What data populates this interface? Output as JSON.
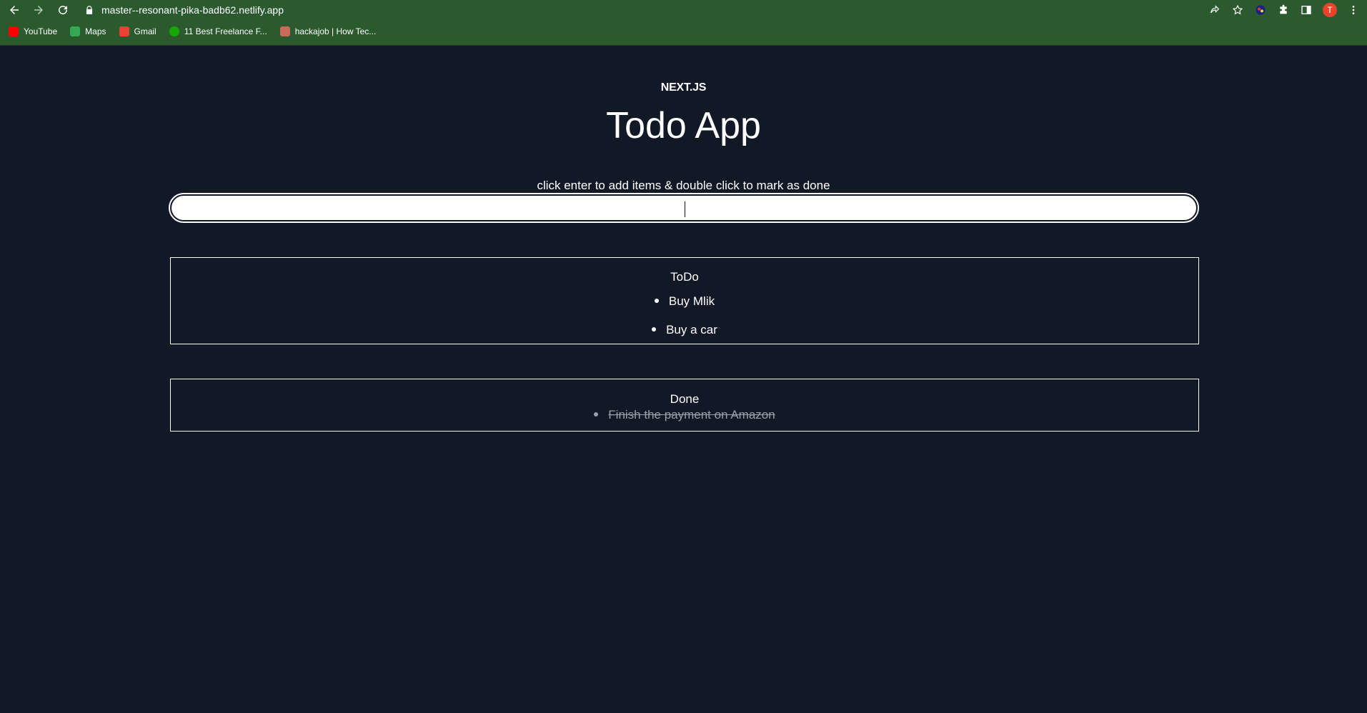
{
  "browser": {
    "url": "master--resonant-pika-badb62.netlify.app",
    "bookmarks": [
      {
        "label": "YouTube",
        "color": "#ff0000"
      },
      {
        "label": "Maps",
        "color": "#34a853"
      },
      {
        "label": "Gmail",
        "color": "#ea4335"
      },
      {
        "label": "11 Best Freelance F...",
        "color": "#14a800"
      },
      {
        "label": "hackajob | How Tec...",
        "color": "#c86b5a"
      }
    ],
    "avatar_letter": "T",
    "chrome_color": "#2b5a2e"
  },
  "page": {
    "brand": "NEXT.JS",
    "title": "Todo App",
    "hint": "click enter to add items & double click to mark as done",
    "input": {
      "value": "",
      "placeholder": ""
    },
    "background": "#111927"
  },
  "todo": {
    "heading": "ToDo",
    "items": [
      "Buy Mlik",
      "Buy a car"
    ]
  },
  "done": {
    "heading": "Done",
    "items": [
      "Finish the payment on Amazon"
    ]
  }
}
